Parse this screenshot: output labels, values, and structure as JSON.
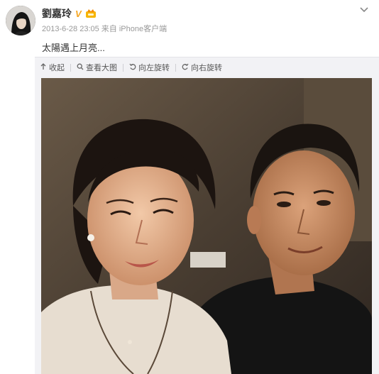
{
  "post": {
    "username": "劉嘉玲",
    "verified_badge": "V",
    "meta": "2013-6-28 23:05 来自 iPhone客户端",
    "text": "太陽遇上月亮..."
  },
  "icons": {
    "more": "chevron-down-icon",
    "member": "member-crown-icon",
    "collapse": "arrow-up-icon",
    "view_large": "magnifier-icon",
    "rotate_left": "rotate-left-icon",
    "rotate_right": "rotate-right-icon"
  },
  "toolbar": {
    "collapse_label": "收起",
    "view_large_label": "查看大图",
    "rotate_left_label": "向左旋转",
    "rotate_right_label": "向右旋转"
  },
  "colors": {
    "verified_badge": "#f5a623",
    "meta_text": "#999999",
    "panel_bg": "#f2f2f5"
  }
}
